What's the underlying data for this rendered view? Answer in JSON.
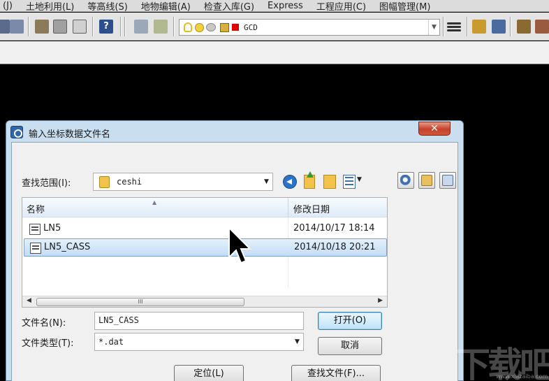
{
  "menubar": {
    "items": [
      "(J)",
      "土地利用(L)",
      "等高线(S)",
      "地物编辑(A)",
      "检查入库(G)",
      "Express",
      "工程应用(C)",
      "图幅管理(M)"
    ]
  },
  "toolbar": {
    "layer_name": "GCD"
  },
  "dialog": {
    "title": "输入坐标数据文件名",
    "close_glyph": "✕",
    "lookin_label": "查找范围(I):",
    "lookin_value": "ceshi",
    "columns": {
      "name": "名称",
      "modified": "修改日期"
    },
    "files": [
      {
        "name": "LN5",
        "date": "2014/10/17 18:14",
        "selected": false
      },
      {
        "name": "LN5_CASS",
        "date": "2014/10/18 20:21",
        "selected": true
      }
    ],
    "scroll_thumb_mark": "III",
    "filename_label": "文件名(N):",
    "filename_value": "LN5_CASS",
    "filetype_label": "文件类型(T):",
    "filetype_value": "*.dat",
    "open_button": "打开(O)",
    "cancel_button": "取消",
    "locate_button": "定位(L)",
    "find_button": "查找文件(F)..."
  },
  "watermark": {
    "text": "下载吧",
    "sub": "www.xiazaiba.com"
  },
  "colors": {
    "accent": "#3c7fb1",
    "selection": "#c4ddf6",
    "title_bar": "#c9dff0",
    "close": "#c6402a"
  }
}
